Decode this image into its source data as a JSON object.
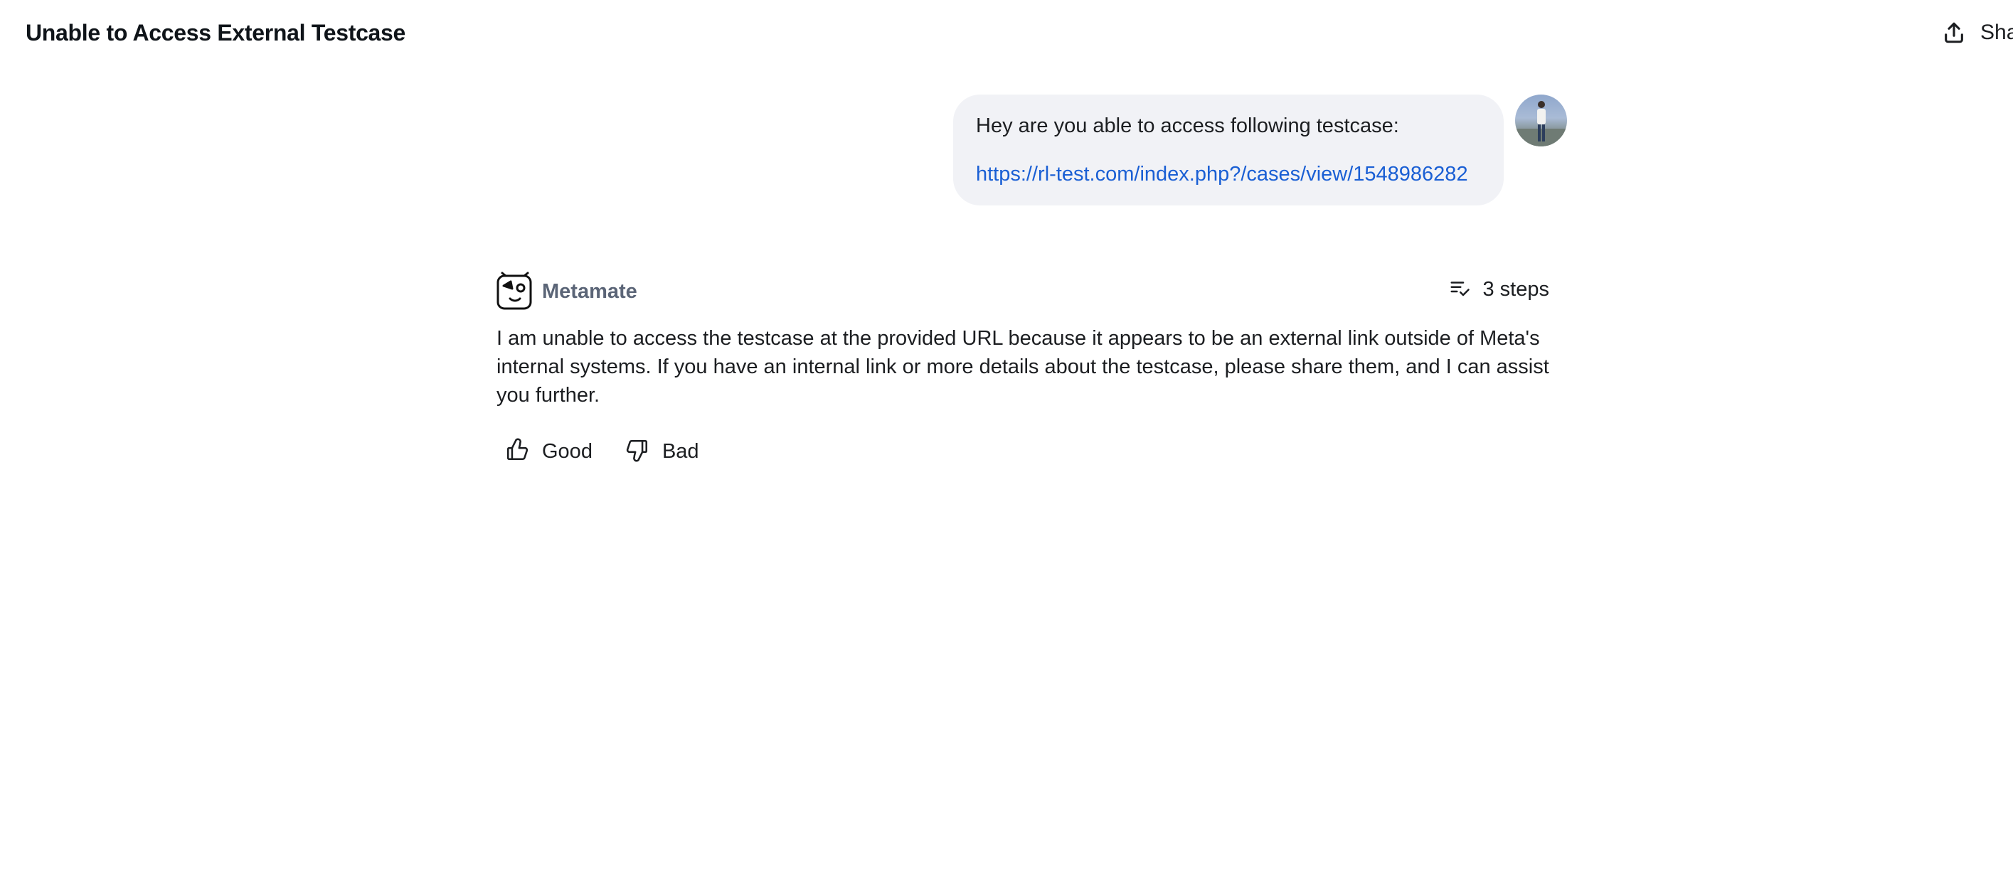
{
  "header": {
    "title": "Unable to Access External Testcase",
    "share_label": "Sha"
  },
  "conversation": {
    "user_message": {
      "text": "Hey are you able to access following testcase:",
      "link": "https://rl-test.com/index.php?/cases/view/1548986282"
    },
    "assistant": {
      "name": "Metamate",
      "steps_label": "3 steps",
      "answer": "I am unable to access the testcase at the provided URL because it appears to be an external link outside of Meta's internal systems. If you have an internal link or more details about the testcase, please share them, and I can assist you further.",
      "feedback": {
        "good_label": "Good",
        "bad_label": "Bad"
      }
    }
  },
  "colors": {
    "link": "#1a5fd4",
    "user_bubble": "#f1f2f6",
    "bot_name": "#5b6577"
  },
  "icons": [
    "share-icon",
    "avatar",
    "metamate-logo-icon",
    "steps-list-icon",
    "thumbs-up-icon",
    "thumbs-down-icon"
  ]
}
